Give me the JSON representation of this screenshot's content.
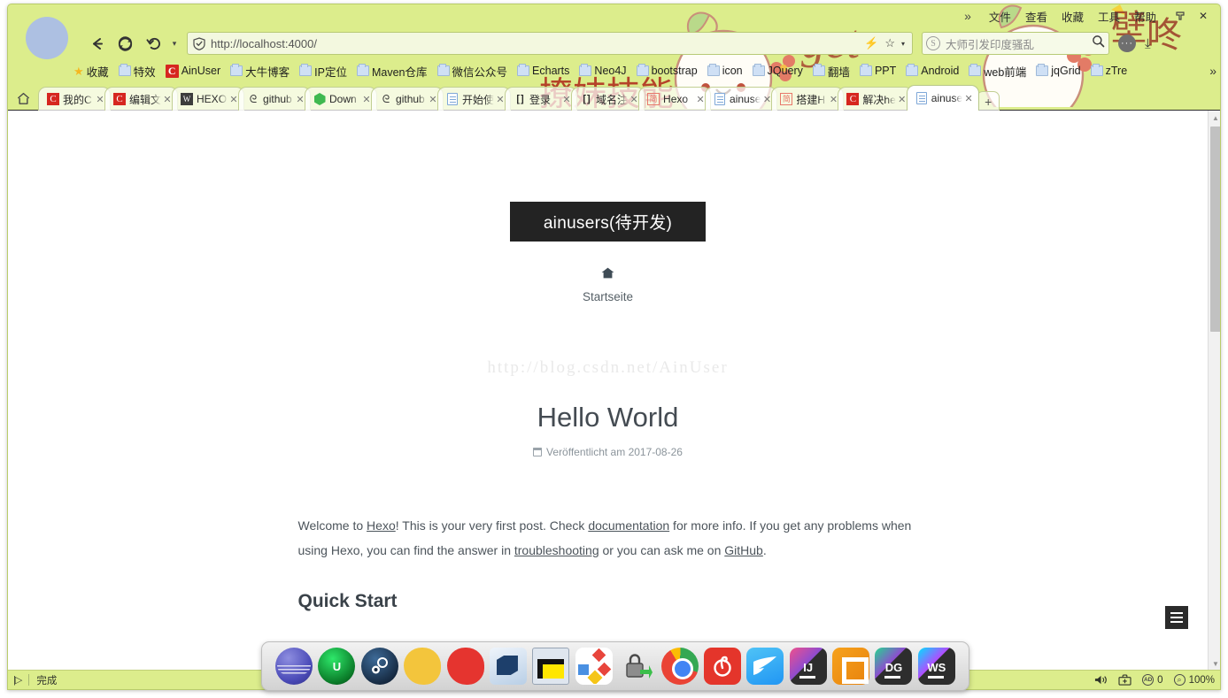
{
  "browser": {
    "menu": [
      "文件",
      "查看",
      "收藏",
      "工具",
      "帮助"
    ],
    "overflow_chevron": "»",
    "window_close": "✕",
    "nav": {
      "back_icon": "back-arrow-icon",
      "reload_icon": "reload-icon",
      "history_icon": "history-undo-icon",
      "caret": "▾"
    },
    "address": {
      "shield_icon": "shield-check-icon",
      "url": "http://localhost:4000/",
      "lightning_icon": "⚡",
      "star_icon": "☆",
      "caret_icon": "▾"
    },
    "search": {
      "engine_logo": "S",
      "placeholder": "大师引发印度骚乱",
      "search_icon": "magnifier-icon"
    },
    "toolbar_right": {
      "menu_dots": "···",
      "download_icon": "⤓"
    },
    "bookmarks": [
      {
        "label": "收藏",
        "icon": "star-icon"
      },
      {
        "label": "特效",
        "icon": "folder-icon"
      },
      {
        "label": "AinUser",
        "icon": "csdn-icon"
      },
      {
        "label": "大牛博客",
        "icon": "folder-icon"
      },
      {
        "label": "IP定位",
        "icon": "folder-icon"
      },
      {
        "label": "Maven仓库",
        "icon": "folder-icon"
      },
      {
        "label": "微信公众号",
        "icon": "folder-icon"
      },
      {
        "label": "Echarts",
        "icon": "folder-icon"
      },
      {
        "label": "Neo4J",
        "icon": "folder-icon"
      },
      {
        "label": "bootstrap",
        "icon": "folder-icon"
      },
      {
        "label": "icon",
        "icon": "folder-icon"
      },
      {
        "label": "JQuery",
        "icon": "folder-icon"
      },
      {
        "label": "翻墙",
        "icon": "folder-icon"
      },
      {
        "label": "PPT",
        "icon": "folder-icon"
      },
      {
        "label": "Android",
        "icon": "folder-icon"
      },
      {
        "label": "web前端",
        "icon": "folder-icon"
      },
      {
        "label": "jqGrid",
        "icon": "folder-icon"
      },
      {
        "label": "zTre",
        "icon": "folder-icon"
      }
    ],
    "bookmarks_overflow": "»",
    "home_button_icon": "home-icon",
    "tabs": [
      {
        "label": "我的C",
        "favicon": "csdn",
        "active": false
      },
      {
        "label": "编辑文",
        "favicon": "csdn",
        "active": false
      },
      {
        "label": "HEXO",
        "favicon": "wiki",
        "active": false
      },
      {
        "label": "github",
        "favicon": "github",
        "active": false
      },
      {
        "label": "Down",
        "favicon": "hexo",
        "active": false
      },
      {
        "label": "github",
        "favicon": "github",
        "active": false
      },
      {
        "label": "开始使",
        "favicon": "doc",
        "active": false
      },
      {
        "label": "登录",
        "favicon": "bracket",
        "active": false
      },
      {
        "label": "域名注",
        "favicon": "bracket",
        "active": false
      },
      {
        "label": "Hexo",
        "favicon": "jianshu",
        "active": false
      },
      {
        "label": "ainuse",
        "favicon": "doc",
        "active": false
      },
      {
        "label": "搭建H",
        "favicon": "jianshu",
        "active": false
      },
      {
        "label": "解决he",
        "favicon": "csdn",
        "active": false
      },
      {
        "label": "ainuse",
        "favicon": "doc",
        "active": true
      }
    ],
    "new_tab_label": "+",
    "close_tab_label": "✕",
    "status": {
      "play_icon": "play-step-icon",
      "text": "完成",
      "speaker_icon": "speaker-icon",
      "toolbox_icon": "toolbox-icon",
      "ad_block_label": "AD",
      "ad_block_count": "0",
      "zoom_icon": "zoom-icon",
      "zoom_level": "100%"
    }
  },
  "page": {
    "site_title": "ainusers(待开发)",
    "nav_home_icon": "home-icon",
    "nav_home_label": "Startseite",
    "watermark": "http://blog.csdn.net/AinUser",
    "post_title": "Hello World",
    "post_meta_prefix": "Veröffentlicht am",
    "post_date": "2017-08-26",
    "calendar_icon": "calendar-icon",
    "paragraph": {
      "part1": "Welcome to ",
      "link1": "Hexo",
      "part2": "! This is your very first post. Check ",
      "link2": "documentation",
      "part3": " for more info. If you get any problems when using Hexo, you can find the answer in ",
      "link3": "troubleshooting",
      "part4": " or you can ask me on ",
      "link4": "GitHub",
      "part5": "."
    },
    "section_heading": "Quick Start",
    "menu_toggle_icon": "hamburger-menu-icon",
    "scrollbar": {
      "up_arrow": "▲",
      "down_arrow": "▼"
    }
  },
  "dock": {
    "items": [
      {
        "name": "crystaldiskinfo",
        "icon": "crystal-icon",
        "label": ""
      },
      {
        "name": "iobit-uninstaller",
        "icon": "iobit-icon",
        "label": "U"
      },
      {
        "name": "steam",
        "icon": "steam-icon",
        "label": ""
      },
      {
        "name": "app-yellow",
        "icon": "cloud-yellow-icon",
        "label": ""
      },
      {
        "name": "app-red",
        "icon": "cloud-red-icon",
        "label": ""
      },
      {
        "name": "virtualbox",
        "icon": "virtualbox-icon",
        "label": ""
      },
      {
        "name": "command-prompt",
        "icon": "terminal-icon",
        "label": ""
      },
      {
        "name": "diagram-app",
        "icon": "diagram-icon",
        "label": ""
      },
      {
        "name": "lock-app",
        "icon": "lock-icon",
        "label": ""
      },
      {
        "name": "google-chrome",
        "icon": "chrome-icon",
        "label": ""
      },
      {
        "name": "netease-music",
        "icon": "netease-icon",
        "label": ""
      },
      {
        "name": "foxmail",
        "icon": "foxmail-icon",
        "label": ""
      },
      {
        "name": "intellij-idea",
        "icon": "idea-icon",
        "label": "IJ"
      },
      {
        "name": "vmware",
        "icon": "vmware-icon",
        "label": ""
      },
      {
        "name": "datagrip",
        "icon": "datagrip-icon",
        "label": "DG"
      },
      {
        "name": "webstorm",
        "icon": "webstorm-icon",
        "label": "WS"
      }
    ]
  },
  "theme": {
    "chrome_bg": "#dced8c",
    "site_title_bg": "#232323",
    "accent_red": "#d6271f",
    "page_bg": "#ffffff"
  }
}
